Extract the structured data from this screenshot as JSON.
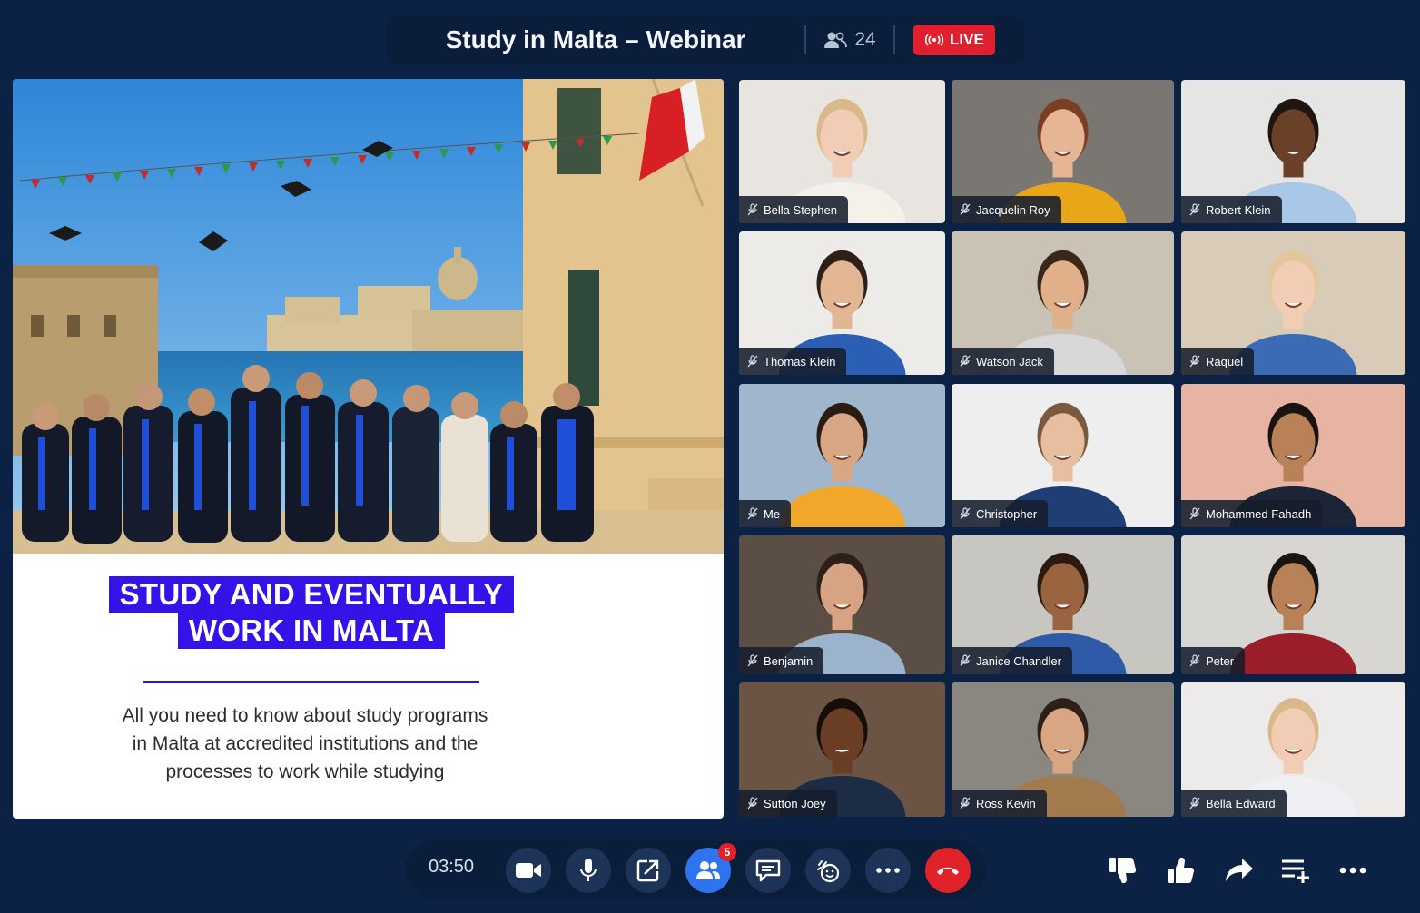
{
  "header": {
    "title": "Study in Malta – Webinar",
    "participant_count": "24",
    "live_label": "LIVE"
  },
  "slide": {
    "heading_line1": "STUDY AND EVENTUALLY",
    "heading_line2": "WORK IN MALTA",
    "body_line1": "All you need to know about study programs",
    "body_line2": "in Malta at accredited institutions and the",
    "body_line3": "processes to work while studying"
  },
  "participants": [
    {
      "name": "Bella Stephen",
      "muted": true
    },
    {
      "name": "Jacquelin Roy",
      "muted": true
    },
    {
      "name": "Robert Klein",
      "muted": true
    },
    {
      "name": "Thomas Klein",
      "muted": true
    },
    {
      "name": "Watson Jack",
      "muted": true
    },
    {
      "name": "Raquel",
      "muted": true
    },
    {
      "name": "Me",
      "muted": true,
      "self": true
    },
    {
      "name": "Christopher",
      "muted": true
    },
    {
      "name": "Mohammed Fahadh",
      "muted": true
    },
    {
      "name": "Benjamin",
      "muted": true
    },
    {
      "name": "Janice Chandler",
      "muted": true
    },
    {
      "name": "Peter",
      "muted": true
    },
    {
      "name": "Sutton Joey",
      "muted": true
    },
    {
      "name": "Ross Kevin",
      "muted": true
    },
    {
      "name": "Bella Edward",
      "muted": true
    }
  ],
  "toolbar": {
    "timer": "03:50",
    "participants_badge": "5",
    "buttons": [
      "video-camera-icon",
      "microphone-icon",
      "share-screen-icon",
      "participants-icon",
      "chat-icon",
      "reactions-icon",
      "more-icon",
      "end-call-icon"
    ],
    "right_actions": [
      "thumbs-down-icon",
      "thumbs-up-icon",
      "share-arrow-icon",
      "add-to-playlist-icon",
      "more-options-icon"
    ]
  },
  "colors": {
    "background": "#0c2244",
    "accent_blue": "#2e74ee",
    "live_red": "#e0202e",
    "slide_heading_bg": "#3412e8"
  }
}
